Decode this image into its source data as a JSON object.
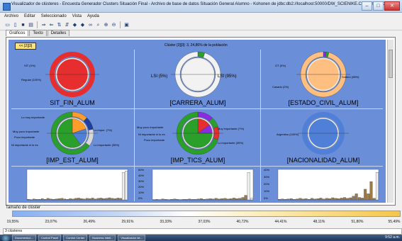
{
  "window": {
    "title": "Visualizador de clústeres - Encuesta Generador Clusters Situación Final - Archivo de base de datos Situación General Alumno - Kohonen de jdbc:db2://localhost:50000/DW_SCIENIKE.CLUSTERMODELS",
    "buttons": {
      "minimize": "–",
      "maximize": "□",
      "close": "✕"
    }
  },
  "menu": [
    "Archivo",
    "Editar",
    "Seleccionado",
    "Vista",
    "Ayuda"
  ],
  "toolbar_icons": [
    "open-icon",
    "new-icon",
    "save-icon",
    "print-icon",
    "arrange-icon",
    "arrange2-icon",
    "sort-icon",
    "sort2-icon",
    "back-icon",
    "forward-icon",
    "binoculars-icon",
    "find-icon",
    "zoom-in-icon",
    "zoom-out-icon",
    "info-icon"
  ],
  "tabs": [
    "Gráficos",
    "Texto",
    "Detalles"
  ],
  "back_button": "<< [2][3]",
  "cluster_title": "Clúster [3][3]: 3, 24,86% de la población",
  "variables": [
    {
      "name": "SIT_FIN_ALUM",
      "labels": [
        "SIT (0%)",
        "Regular (100%)"
      ]
    },
    {
      "name": "[CARRERA_ALUM]",
      "labels": [
        "LSI (5%)",
        "LSI (95%)"
      ]
    },
    {
      "name": "[ESTADO_CIVIL_ALUM]",
      "labels": [
        "OT (0%)",
        "Soltero (98%)",
        "Casado (2%)"
      ]
    },
    {
      "name": "[IMP_EST_ALUM]",
      "labels": [
        "Lo muy importante",
        "Muy poco importante",
        "Poco importante",
        "Ni importante ni lo es",
        "Lo impor. (?%)",
        "Lo importante (35%)"
      ]
    },
    {
      "name": "[IMP_TICS_ALUM]",
      "labels": [
        "Muy poco importante",
        "Ni importante ni lo es",
        "Poco importante",
        "Muy importante (?%)",
        "Lo importante (35%)"
      ]
    },
    {
      "name": "[NACIONALIDAD_ALUM]",
      "labels": [
        "Argentino (100%)"
      ]
    }
  ],
  "histogram_ticks": [
    [
      "",
      "",
      "",
      ""
    ],
    [
      "50%",
      "40%",
      "30%",
      "20%",
      "10%",
      "0%"
    ],
    [
      "40%",
      "30%",
      "20%",
      "10%",
      "0%"
    ]
  ],
  "pie_data": {
    "sit_fin": {
      "outer": [
        [
          1.0,
          "#e62e2e"
        ]
      ],
      "inner": [
        [
          1.0,
          "#e62e2e"
        ]
      ]
    },
    "carrera": {
      "outer": [
        [
          0.05,
          "#2aa02a"
        ],
        [
          0.95,
          "#f2f2f2"
        ]
      ],
      "inner": [
        [
          1.0,
          "#f2f2f2"
        ]
      ]
    },
    "estado_civil": {
      "outer": [
        [
          0.02,
          "#8a2be2"
        ],
        [
          0.02,
          "#2aa02a"
        ],
        [
          0.96,
          "#ffbf80"
        ]
      ],
      "inner": [
        [
          1.0,
          "#ffbf80"
        ]
      ]
    },
    "imp_est": {
      "outer": [
        [
          0.12,
          "#ff9c2a"
        ],
        [
          0.1,
          "#1f3fa0"
        ],
        [
          0.13,
          "#d9d9d9"
        ],
        [
          0.65,
          "#2aa02a"
        ]
      ],
      "inner": [
        [
          0.2,
          "#ff9c2a"
        ],
        [
          0.2,
          "#4f7fd6"
        ],
        [
          0.6,
          "#2aa02a"
        ]
      ]
    },
    "imp_tics": {
      "outer": [
        [
          0.12,
          "#8a2be2"
        ],
        [
          0.08,
          "#2aa02a"
        ],
        [
          0.1,
          "#e62e2e"
        ],
        [
          0.7,
          "#2aa02a"
        ]
      ],
      "inner": [
        [
          0.15,
          "#e62e2e"
        ],
        [
          0.1,
          "#8a2be2"
        ],
        [
          0.75,
          "#2aa02a"
        ]
      ]
    },
    "nacionalidad": {
      "outer": [
        [
          1.0,
          "#4f7fd6"
        ]
      ],
      "inner": [
        [
          1.0,
          "#4f7fd6"
        ]
      ]
    }
  },
  "histograms": [
    {
      "values": [
        0.02,
        0.01,
        0.03,
        0.02,
        0.02,
        0.04,
        0.02,
        0.05,
        0.03,
        0.02,
        0.03,
        0.04,
        0.05,
        0.03,
        0.02,
        0.04,
        0.03,
        0.05,
        0.06,
        0.04,
        0.03,
        0.05,
        0.04,
        0.06,
        0.03,
        0.05,
        0.06,
        0.04,
        0.05,
        0.07,
        0.05,
        0.04,
        0.06,
        0.05,
        0.9,
        0.95
      ]
    },
    {
      "values": [
        0.01,
        0.02,
        0.01,
        0.03,
        0.02,
        0.01,
        0.02,
        0.03,
        0.02,
        0.01,
        0.02,
        0.02,
        0.03,
        0.02,
        0.02,
        0.03,
        0.04,
        0.02,
        0.03,
        0.04,
        0.03,
        0.05,
        0.03,
        0.04,
        0.05,
        0.03,
        0.04,
        0.06,
        0.04,
        0.05,
        0.08,
        0.15,
        0.9,
        0.05
      ]
    },
    {
      "values": [
        0.02,
        0.03,
        0.02,
        0.03,
        0.04,
        0.02,
        0.03,
        0.05,
        0.03,
        0.04,
        0.02,
        0.05,
        0.03,
        0.04,
        0.06,
        0.03,
        0.05,
        0.04,
        0.07,
        0.05,
        0.04,
        0.06,
        0.08,
        0.05,
        0.07,
        0.12,
        0.2,
        0.08,
        0.06,
        0.35,
        0.2,
        0.6,
        0.05,
        0.9
      ]
    }
  ],
  "size_bar": {
    "label": "Tamaño de clúster",
    "ticks": [
      "19,55%",
      "23,07%",
      "26,49%",
      "29,91%",
      "33,33%",
      "37,03%",
      "40,72%",
      "44,41%",
      "48,11%",
      "51,80%",
      "55,49%"
    ]
  },
  "status": "3 clústeres",
  "taskbar": {
    "items": [
      "Inicio",
      "Documento1...",
      "Control Panel",
      "Control Center",
      "Business Intell...",
      "Visualizador de..."
    ],
    "clock": "9:52 a.m."
  }
}
